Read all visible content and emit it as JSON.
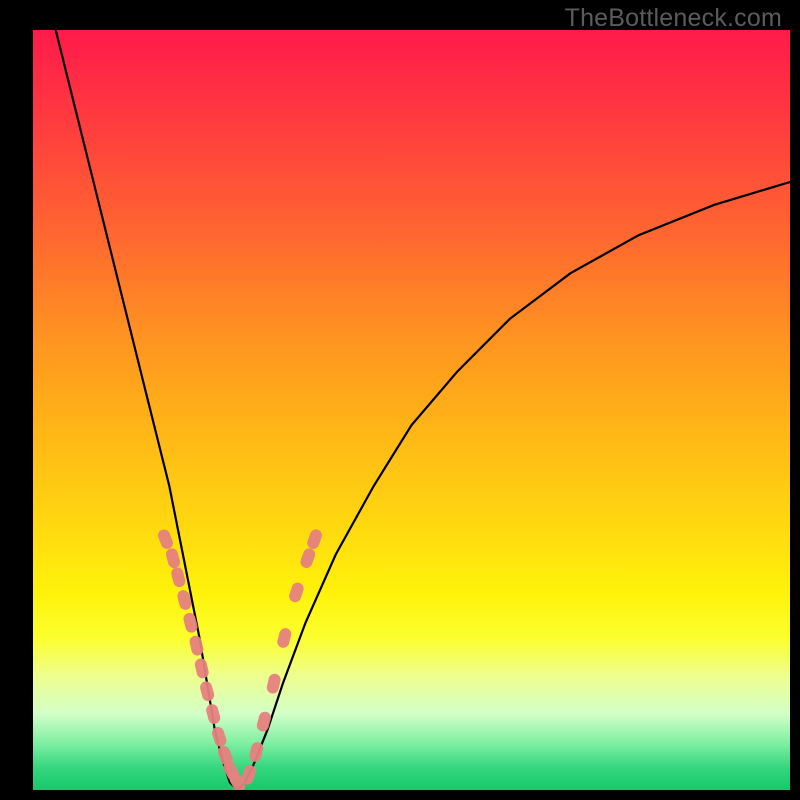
{
  "watermark": {
    "text": "TheBottleneck.com"
  },
  "chart_data": {
    "type": "line",
    "title": "",
    "xlabel": "",
    "ylabel": "",
    "xlim": [
      0,
      100
    ],
    "ylim": [
      0,
      100
    ],
    "grid": false,
    "legend": false,
    "series": [
      {
        "name": "bottleneck-curve",
        "x": [
          3,
          6,
          9,
          12,
          15,
          18,
          20,
          22,
          23,
          24,
          25,
          26,
          27,
          28,
          29,
          31,
          33,
          36,
          40,
          45,
          50,
          56,
          63,
          71,
          80,
          90,
          100
        ],
        "y": [
          100,
          88,
          76,
          64,
          52,
          40,
          30,
          20,
          14,
          8,
          4,
          1,
          0,
          1,
          3,
          8,
          14,
          22,
          31,
          40,
          48,
          55,
          62,
          68,
          73,
          77,
          80
        ]
      }
    ],
    "markers": [
      {
        "name": "left-branch-dots",
        "x": [
          17.5,
          18.5,
          19.2,
          20.0,
          20.8,
          21.6,
          22.3,
          23.0,
          23.8,
          24.6,
          25.4,
          26.2,
          27.0
        ],
        "y": [
          33.0,
          30.5,
          28.0,
          25.0,
          22.0,
          19.0,
          16.0,
          13.0,
          10.0,
          7.0,
          4.5,
          2.5,
          1.0
        ]
      },
      {
        "name": "right-branch-dots",
        "x": [
          28.5,
          29.5,
          30.5,
          31.8,
          33.2,
          34.8,
          36.3,
          37.2
        ],
        "y": [
          2.0,
          5.0,
          9.0,
          14.0,
          20.0,
          26.0,
          30.5,
          33.0
        ]
      }
    ],
    "background_gradient": {
      "top": "#ff1a4a",
      "upper_mid": "#ff9221",
      "mid": "#ffd510",
      "lower_mid": "#fcff2e",
      "bottom": "#17c86a"
    },
    "curve_color": "#000000",
    "marker_color": "#e6817e"
  }
}
